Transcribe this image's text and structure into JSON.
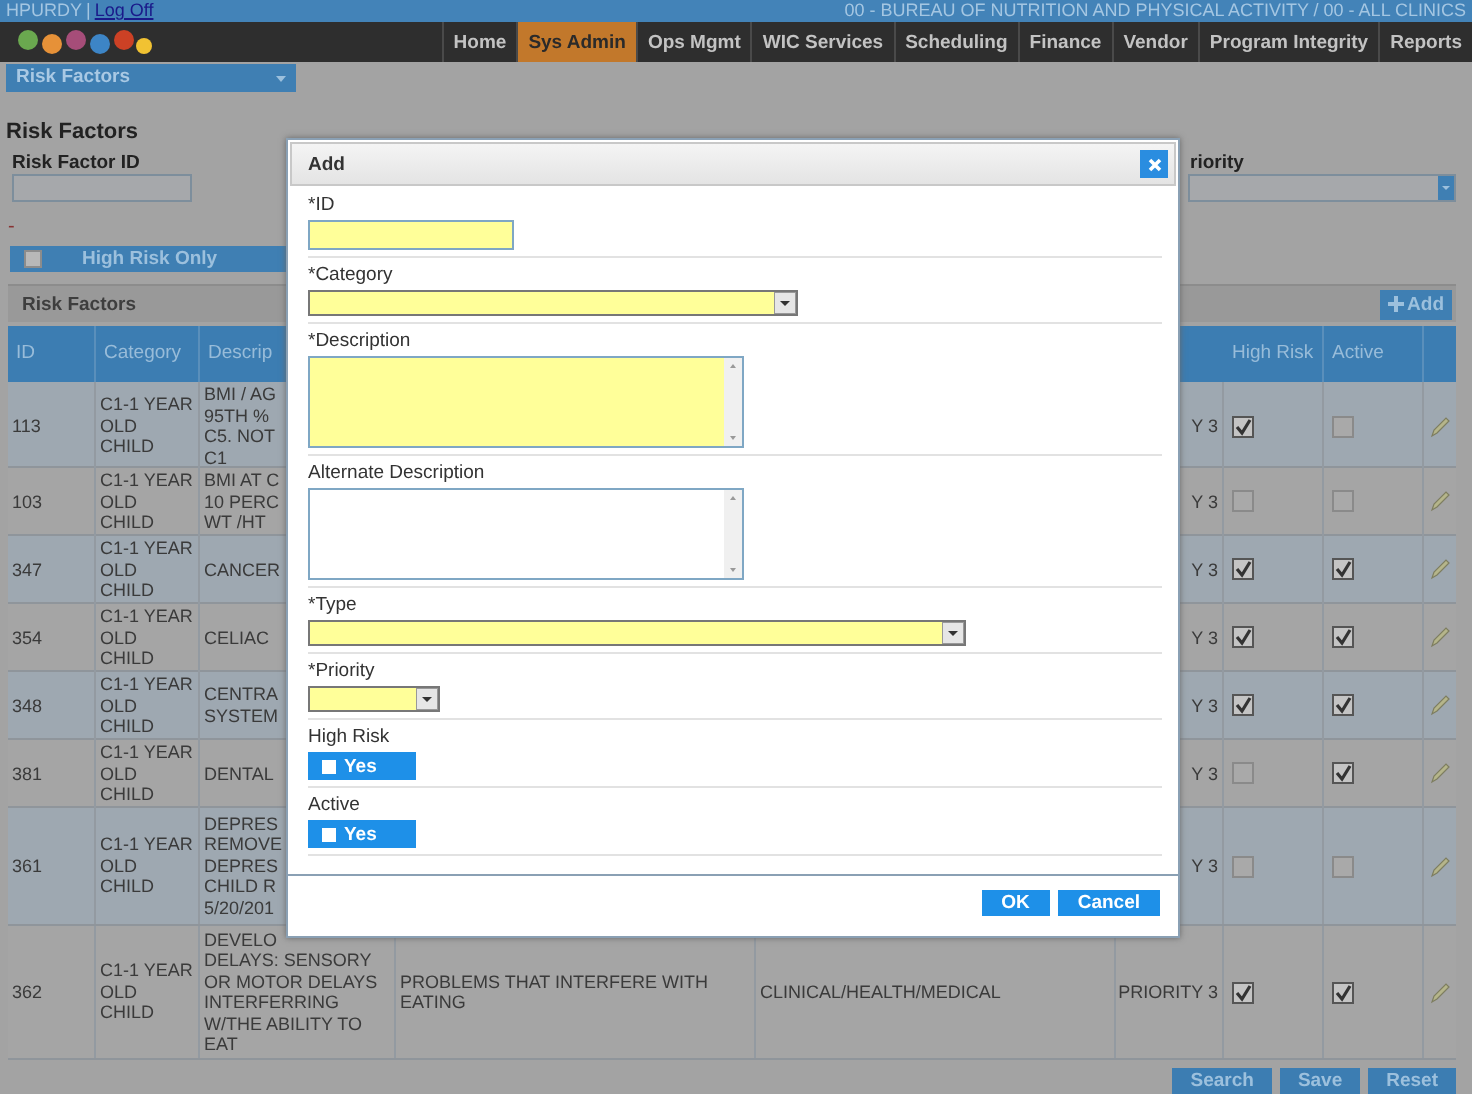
{
  "user_bar": {
    "user": "HPURDY",
    "separator": "|",
    "logout_link": "Log Off",
    "agency": "00 - BUREAU OF NUTRITION AND PHYSICAL ACTIVITY / 00 - ALL CLINICS"
  },
  "nav": {
    "items": [
      {
        "label": "Home",
        "selected": false
      },
      {
        "label": "Sys Admin",
        "selected": true
      },
      {
        "label": "Ops Mgmt",
        "selected": false
      },
      {
        "label": "WIC Services",
        "selected": false
      },
      {
        "label": "Scheduling",
        "selected": false
      },
      {
        "label": "Finance",
        "selected": false
      },
      {
        "label": "Vendor",
        "selected": false
      },
      {
        "label": "Program Integrity",
        "selected": false
      },
      {
        "label": "Reports",
        "selected": false
      }
    ]
  },
  "module_select": {
    "value": "Risk Factors"
  },
  "page_title": "Risk Factors",
  "filters": {
    "risk_factor_id": {
      "label": "Risk Factor ID"
    },
    "priority": {
      "label": "riority"
    }
  },
  "collapse_marker": "-",
  "high_risk_only": {
    "label": "High Risk Only",
    "checked": false
  },
  "grid": {
    "title": "Risk Factors",
    "add_button": "Add",
    "columns": [
      {
        "label": "ID"
      },
      {
        "label": "Category"
      },
      {
        "label": "Descrip"
      },
      {
        "label": "High Risk"
      },
      {
        "label": "Active"
      }
    ],
    "rows": [
      {
        "id": "113",
        "category": "C1-1 YEAR OLD CHILD",
        "description": "BMI / AG\n95TH %\nC5. NOT\nC1",
        "priority": "Y 3",
        "high_risk": true,
        "active": false
      },
      {
        "id": "103",
        "category": "C1-1 YEAR OLD CHILD",
        "description": "BMI AT C\n10 PERC\nWT /HT",
        "priority": "Y 3",
        "high_risk": false,
        "active": false
      },
      {
        "id": "347",
        "category": "C1-1 YEAR OLD CHILD",
        "description": "CANCER",
        "priority": "Y 3",
        "high_risk": true,
        "active": true
      },
      {
        "id": "354",
        "category": "C1-1 YEAR OLD CHILD",
        "description": "CELIAC",
        "priority": "Y 3",
        "high_risk": true,
        "active": true
      },
      {
        "id": "348",
        "category": "C1-1 YEAR OLD CHILD",
        "description": "CENTRA\nSYSTEM",
        "priority": "Y 3",
        "high_risk": true,
        "active": true
      },
      {
        "id": "381",
        "category": "C1-1 YEAR OLD CHILD",
        "description": "DENTAL",
        "priority": "Y 3",
        "high_risk": false,
        "active": true
      },
      {
        "id": "361",
        "category": "C1-1 YEAR OLD CHILD",
        "description": "DEPRES\nREMOVE\nDEPRES\nCHILD R\n5/20/201",
        "priority": "Y 3",
        "high_risk": false,
        "active": false
      },
      {
        "id": "362",
        "category": "C1-1 YEAR OLD CHILD",
        "description": "DEVELO\nDELAYS: SENSORY\nOR MOTOR DELAYS\nINTERFERRING\nW/THE ABILITY TO\nEAT",
        "alternate_description": "PROBLEMS THAT INTERFERE WITH EATING",
        "type": "CLINICAL/HEALTH/MEDICAL",
        "priority": "PRIORITY 3",
        "high_risk": true,
        "active": true
      }
    ]
  },
  "actions": [
    "Search",
    "Save",
    "Reset"
  ],
  "dialog": {
    "title": "Add",
    "fields": [
      {
        "kind": "text",
        "label": "*ID",
        "required": true
      },
      {
        "kind": "select",
        "label": "*Category",
        "required": true
      },
      {
        "kind": "textarea",
        "label": "*Description",
        "required": true
      },
      {
        "kind": "textarea",
        "label": "Alternate Description",
        "required": false
      },
      {
        "kind": "select",
        "label": "*Type",
        "required": true
      },
      {
        "kind": "select",
        "label": "*Priority",
        "required": true
      },
      {
        "kind": "toggle",
        "label": "High Risk",
        "button": "Yes",
        "checked": false
      },
      {
        "kind": "toggle",
        "label": "Active",
        "button": "Yes",
        "checked": false
      }
    ],
    "buttons": [
      "OK",
      "Cancel"
    ]
  }
}
